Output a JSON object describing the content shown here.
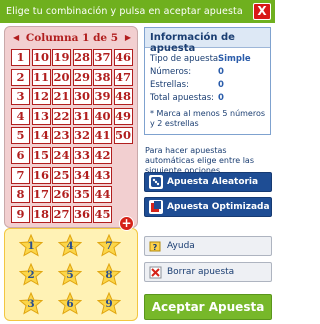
{
  "header": {
    "title": "Elige tu combinación y pulsa en aceptar apuesta",
    "close_label": "X"
  },
  "numbers_panel": {
    "prev_icon": "arrow-left-icon",
    "next_icon": "arrow-right-icon",
    "column_label": "Columna 1 de 5",
    "numbers": [
      [
        "1",
        "10",
        "19",
        "28",
        "37",
        "46"
      ],
      [
        "2",
        "11",
        "20",
        "29",
        "38",
        "47"
      ],
      [
        "3",
        "12",
        "21",
        "30",
        "39",
        "48"
      ],
      [
        "4",
        "13",
        "22",
        "31",
        "40",
        "49"
      ],
      [
        "5",
        "14",
        "23",
        "32",
        "41",
        "50"
      ],
      [
        "6",
        "15",
        "24",
        "33",
        "42",
        ""
      ],
      [
        "7",
        "16",
        "25",
        "34",
        "43",
        ""
      ],
      [
        "8",
        "17",
        "26",
        "35",
        "44",
        ""
      ],
      [
        "9",
        "18",
        "27",
        "36",
        "45",
        ""
      ]
    ]
  },
  "add_icon": "plus-circle-icon",
  "stars_panel": {
    "stars": [
      [
        "1",
        "4",
        "7"
      ],
      [
        "2",
        "5",
        "8"
      ],
      [
        "3",
        "6",
        "9"
      ]
    ]
  },
  "info": {
    "title": "Información de apuesta",
    "rows": [
      {
        "label": "Tipo de apuesta:",
        "value": "Simple"
      },
      {
        "label": "Números:",
        "value": "0"
      },
      {
        "label": "Estrellas:",
        "value": "0"
      },
      {
        "label": "Total apuestas:",
        "value": "0"
      }
    ],
    "note": "* Marca al menos 5 números y 2 estrellas"
  },
  "auto_text": "Para hacer apuestas automáticas elige entre las siguiente opciones",
  "buttons": {
    "random": {
      "label": "Apuesta Aleatoria",
      "icon": "dice-icon"
    },
    "optimized": {
      "label": "Apuesta Optimizada",
      "icon": "optimize-icon"
    },
    "help": {
      "label": "Ayuda",
      "icon": "help-icon"
    },
    "clear": {
      "label": "Borrar apuesta",
      "icon": "clear-icon"
    },
    "accept": {
      "label": "Aceptar Apuesta"
    }
  },
  "colors": {
    "header_green": "#6fb01e",
    "number_red": "#b11e1e",
    "numbers_bg": "#f2cfd0",
    "stars_bg": "#fff2b5",
    "star_fill": "#fbd64a",
    "button_blue": "#1e4d94",
    "accept_green": "#77b82a"
  }
}
